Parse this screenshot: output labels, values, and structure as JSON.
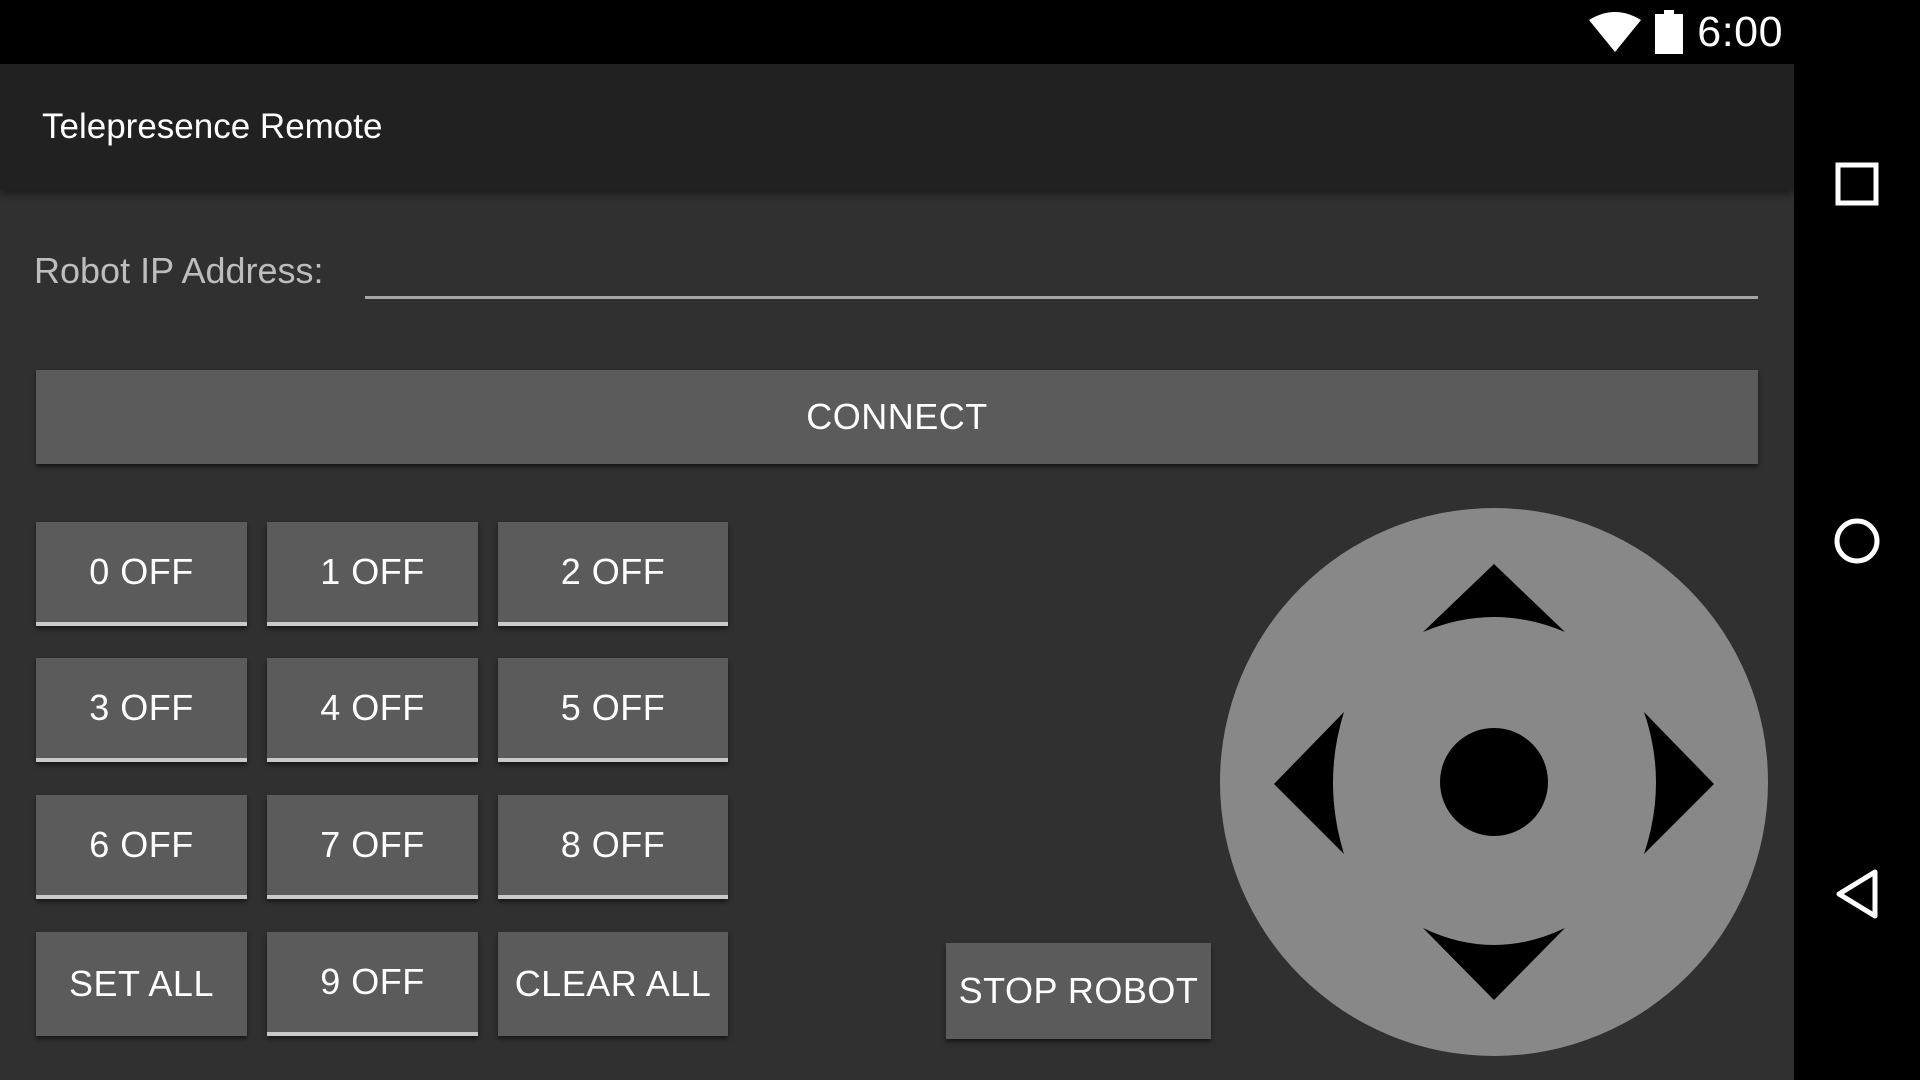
{
  "status_bar": {
    "time": "6:00",
    "wifi_icon": "wifi-icon",
    "battery_icon": "battery-icon"
  },
  "app_bar": {
    "title": "Telepresence Remote"
  },
  "form": {
    "ip_label": "Robot IP Address:",
    "ip_value": "",
    "ip_placeholder": ""
  },
  "connect_button": {
    "label": "CONNECT"
  },
  "grid_buttons": [
    {
      "label": "0 OFF"
    },
    {
      "label": "1 OFF"
    },
    {
      "label": "2 OFF"
    },
    {
      "label": "3 OFF"
    },
    {
      "label": "4 OFF"
    },
    {
      "label": "5 OFF"
    },
    {
      "label": "6 OFF"
    },
    {
      "label": "7 OFF"
    },
    {
      "label": "8 OFF"
    },
    {
      "label": "SET ALL"
    },
    {
      "label": "9 OFF"
    },
    {
      "label": "CLEAR ALL"
    }
  ],
  "stop_button": {
    "label": "STOP ROBOT"
  },
  "nav_bar": {
    "recents_icon": "square-icon",
    "home_icon": "circle-icon",
    "back_icon": "triangle-back-icon"
  },
  "colors": {
    "background": "#303030",
    "app_bar": "#212121",
    "button": "#5b5b5c",
    "dpad": "#888888",
    "accent_line": "#c9c9c9"
  }
}
